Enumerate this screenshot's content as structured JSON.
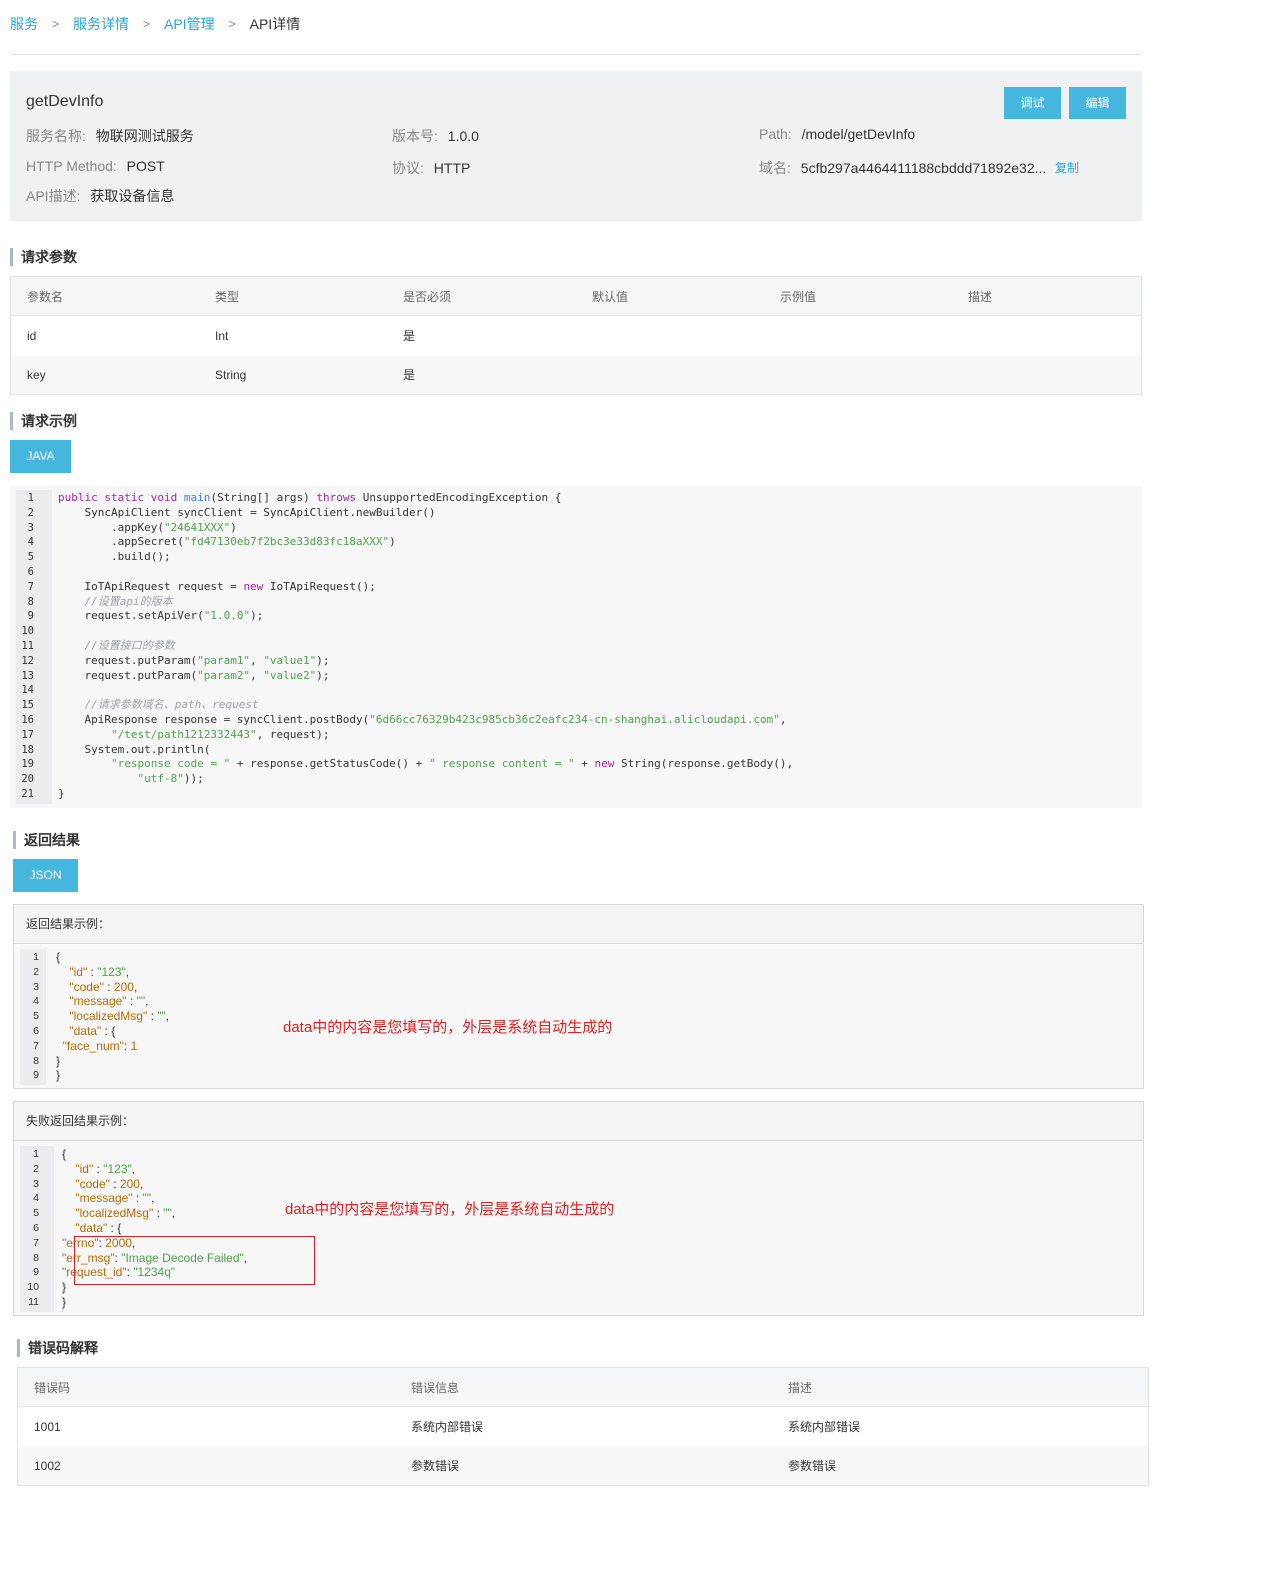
{
  "breadcrumb": {
    "items": [
      "服务",
      "服务详情",
      "API管理"
    ],
    "current": "API详情",
    "separator": ">"
  },
  "api": {
    "name": "getDevInfo",
    "debug_label": "调试",
    "edit_label": "编辑",
    "service_name_label": "服务名称:",
    "service_name": "物联网测试服务",
    "version_label": "版本号:",
    "version": "1.0.0",
    "path_label": "Path:",
    "path": "/model/getDevInfo",
    "method_label": "HTTP Method:",
    "method": "POST",
    "protocol_label": "协议:",
    "protocol": "HTTP",
    "domain_label": "域名:",
    "domain": "5cfb297a4464411188cbddd71892e32...",
    "copy_label": "复制",
    "desc_label": "API描述:",
    "desc": "获取设备信息"
  },
  "request_params": {
    "title": "请求参数",
    "columns": [
      "参数名",
      "类型",
      "是否必须",
      "默认值",
      "示例值",
      "描述"
    ],
    "rows": [
      [
        "id",
        "Int",
        "是",
        "",
        "",
        ""
      ],
      [
        "key",
        "String",
        "是",
        "",
        "",
        ""
      ]
    ]
  },
  "request_example": {
    "title": "请求示例",
    "lang_label": "JAVA"
  },
  "return_result": {
    "title": "返回结果",
    "format_label": "JSON",
    "success_title": "返回结果示例：",
    "fail_title": "失败返回结果示例：",
    "annotation": "data中的内容是您填写的，外层是系统自动生成的"
  },
  "error_codes": {
    "title": "错误码解释",
    "columns": [
      "错误码",
      "错误信息",
      "描述"
    ],
    "rows": [
      [
        "1001",
        "系统内部错误",
        "系统内部错误"
      ],
      [
        "1002",
        "参数错误",
        "参数错误"
      ]
    ]
  },
  "colors": {
    "accent": "#45b6de",
    "link": "#2aa5d6",
    "annotation": "#e02020",
    "panel": "#f0f1f3"
  }
}
